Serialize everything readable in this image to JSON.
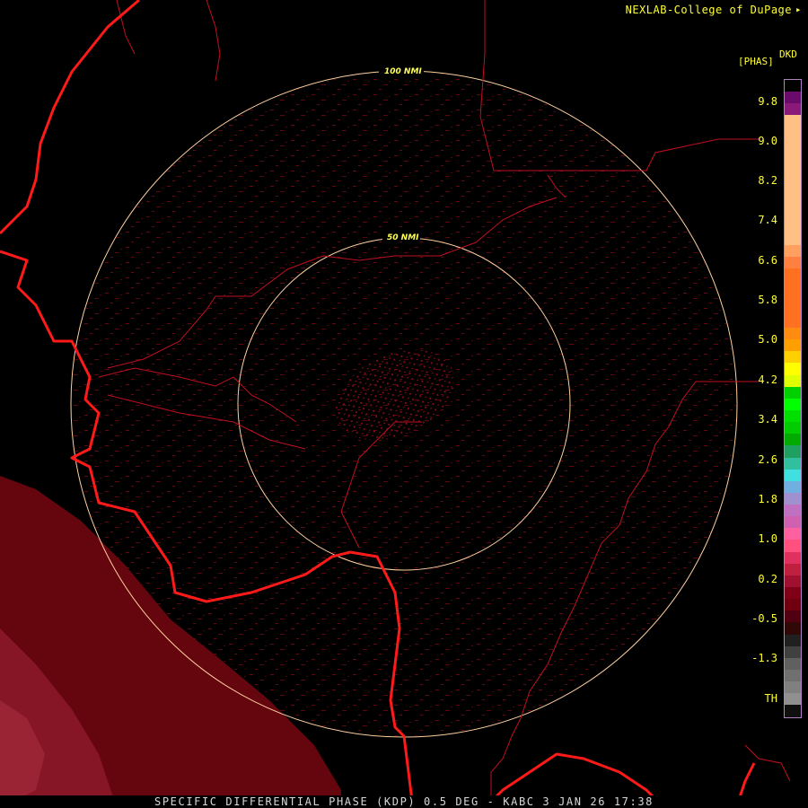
{
  "credit": "NEXLAB-College of DuPage",
  "credit_icon": "nexlab-logo-icon",
  "legend": {
    "units": "[PHAS]",
    "product": "DKD",
    "ticks": [
      "9.8",
      "9.0",
      "8.2",
      "7.4",
      "6.6",
      "5.8",
      "5.0",
      "4.2",
      "3.4",
      "2.6",
      "1.8",
      "1.0",
      "0.2",
      "-0.5",
      "-1.3",
      "TH"
    ],
    "colors": [
      "#000000",
      "#6a0a6a",
      "#8a1a7a",
      "#ffbf85",
      "#ffbf85",
      "#ffbf85",
      "#ffbf85",
      "#ffbf85",
      "#ffbf85",
      "#ffbf85",
      "#ffbf85",
      "#ffbf85",
      "#ffbf85",
      "#ffbf85",
      "#ffa060",
      "#ff8040",
      "#ff7020",
      "#ff7020",
      "#ff7020",
      "#ff7020",
      "#ff7020",
      "#ff8c10",
      "#ffa000",
      "#ffd000",
      "#ffff00",
      "#e0ff00",
      "#00d000",
      "#00ff00",
      "#00e000",
      "#00cc00",
      "#00aa00",
      "#20a060",
      "#30c0a0",
      "#40e0e0",
      "#70b0e0",
      "#a090d0",
      "#c070c0",
      "#d060b0",
      "#ff60a0",
      "#ff5080",
      "#e03060",
      "#c02040",
      "#a01030",
      "#800018",
      "#700010",
      "#500010",
      "#300808",
      "#202020",
      "#404040",
      "#606060",
      "#707070",
      "#808080",
      "#909090",
      "#101010"
    ]
  },
  "rings": {
    "outer_label": "100 NMI",
    "inner_label": "50 NMI"
  },
  "footer": "SPECIFIC DIFFERENTIAL PHASE (KDP) 0.5 DEG - KABC 3 JAN 26 17:38"
}
